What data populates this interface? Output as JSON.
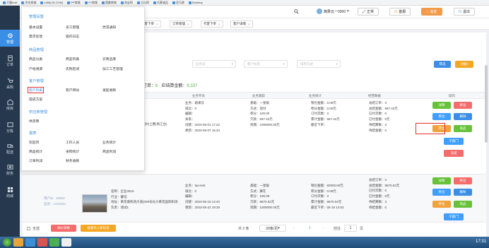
{
  "bookmarks": [
    "天猫mall",
    "京东商城",
    "1688(JD.COM)",
    "PP商城",
    "YY商城",
    "国美商城",
    "淘宝网",
    "当当网",
    "凡客诚品",
    "亚马逊",
    "Bobiring"
  ],
  "sidebar": {
    "items": [
      {
        "label": "管理",
        "icon": "gear-icon"
      },
      {
        "label": "订单",
        "icon": "order-icon"
      },
      {
        "label": "采购",
        "icon": "cart-icon"
      },
      {
        "label": "库房",
        "icon": "warehouse-icon"
      },
      {
        "label": "分拣",
        "icon": "sort-icon"
      },
      {
        "label": "配送",
        "icon": "truck-icon"
      },
      {
        "label": "财务",
        "icon": "finance-icon"
      },
      {
        "label": "商城",
        "icon": "shop-icon"
      }
    ]
  },
  "header": {
    "user": "蔬果云一0000",
    "normal_btn": "正常",
    "service_btn": "客服",
    "message_btn": "消息",
    "exit_btn": "退出"
  },
  "tabs": [
    "代客下单",
    "订单管理",
    "代客下单",
    "客户详情"
  ],
  "filters": {
    "f1": "业务员",
    "f2": "客户标签",
    "f3": "排序方式",
    "filter_btn": "筛选",
    "more_btn": "功能"
  },
  "summary": {
    "label1": "订单：",
    "orders": "6",
    "label2": "应结算金额：",
    "amount": "9,337"
  },
  "table_headers": [
    "业务专员",
    "业务跟踪",
    "业务统计",
    "经营数据",
    "操作"
  ],
  "rows": [
    {
      "address": "荆州上塞(商江台)",
      "salesman": [
        "业务：蔬果云",
        "排比：0",
        "编辑：",
        "关系：",
        "创建：2023-06-01 17:22",
        "更新：2023-06-07 16:34"
      ],
      "tracking": [
        "基础：一星级",
        "方式：现付",
        "积分：100.00",
        "欠款：667.42元",
        "到期：1000000.00元"
      ],
      "stats": [
        "钱包金额：0.00元",
        "积分金额：0.00元",
        "订付次数：3",
        "累计金额：667.42元",
        "最近下单："
      ],
      "biz": [
        "总结订单：3",
        "总结金额：667.42元",
        "已付次数：0",
        "已付金额：0元",
        "待结算数：3",
        "待结金额：0"
      ]
    },
    {
      "id_label": "用户id：33953",
      "code_label": "自合：1223344",
      "company": [
        "名称：企业0510",
        "行业：餐馆",
        "地址：黄花塘机场大道(009号长沙黄花国际机场",
        "负责：测试1"
      ],
      "salesman": [
        "业务：tao-test",
        "排比：0",
        "编辑：",
        "创建：2023-05-16 14:40",
        "更新：2023-05-22 19:29"
      ],
      "tracking": [
        "基础：一星级",
        "方式：舞在",
        "积分：100.00",
        "欠款：8670.02元",
        "到期：1000000.00元"
      ],
      "stats": [
        "钱包金额：60000.00元",
        "积分金额：0.00元",
        "订付次数：3",
        "累计金额：8670.02元",
        "最近下单：05-19 14:53"
      ],
      "biz": [
        "总结订单：3",
        "总结金额：8670.02元",
        "已付次数：0",
        "已付金额：0元",
        "待结算数：3",
        "待结金额：0"
      ]
    }
  ],
  "actions": {
    "edit": "详情",
    "delete": "移出",
    "order": "移出",
    "assign": "转化",
    "goods": "商品",
    "sub": "子部门",
    "del": "删除",
    "freeze": "冻结"
  },
  "footer": {
    "select_all": "全选",
    "batch1": "调价转换",
    "batch2": "批量导入新标签",
    "total": "共 2 条",
    "per_page": "20条/页",
    "page": "1",
    "goto": "前往",
    "goto_page": "1",
    "page_suffix": "页"
  },
  "menu": {
    "sections": [
      {
        "title": "管理设置",
        "items": [
          "基本设置",
          "员工管理",
          "异常通知",
          "需求反馈",
          "操作日志"
        ]
      },
      {
        "title": "商品管理",
        "items": [
          "商品分类",
          "商品列表",
          "云商品库",
          "产地溯源",
          "农残检测",
          "加工工艺管理"
        ]
      },
      {
        "title": "客户管理",
        "items": [
          "客户列表",
          "客户拜访",
          "发起收款",
          "提成方案"
        ]
      },
      {
        "title": "供应商管理",
        "items": [
          "供货商"
        ]
      },
      {
        "title": "报表",
        "items": [
          "欢迎页",
          "工作人员",
          "业务统计",
          "商品统计",
          "采购统计",
          "商品利润",
          "订单利润",
          "财务收款"
        ]
      }
    ]
  },
  "taskbar": {
    "time": "17:31"
  }
}
